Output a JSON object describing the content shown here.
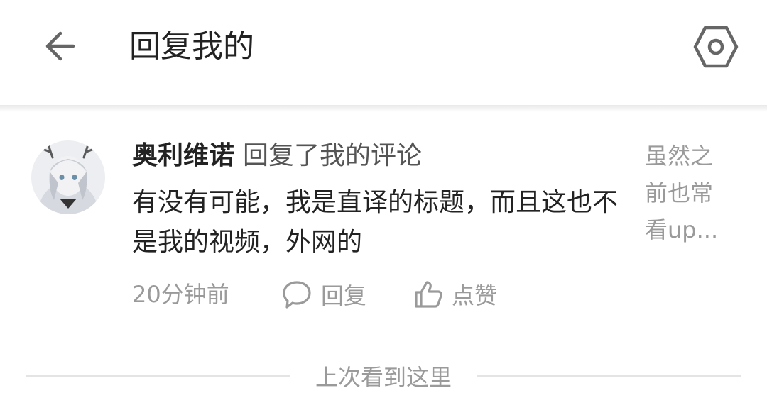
{
  "header": {
    "title": "回复我的",
    "back_icon": "arrow-left-icon",
    "settings_icon": "hexagon-settings-icon"
  },
  "notification": {
    "username": "奥利维诺",
    "action": "回复了我的评论",
    "content": "有没有可能，我是直译的标题，而且这也不是我的视频，外网的",
    "quote": "虽然之前也常看up...",
    "time": "20分钟前",
    "reply_label": "回复",
    "like_label": "点赞",
    "reply_icon": "comment-bubble-icon",
    "like_icon": "thumbs-up-icon"
  },
  "divider": {
    "label": "上次看到这里"
  },
  "colors": {
    "text_primary": "#222222",
    "text_secondary": "#9a9a9a",
    "icon": "#666666",
    "divider": "#e4e4e4"
  }
}
